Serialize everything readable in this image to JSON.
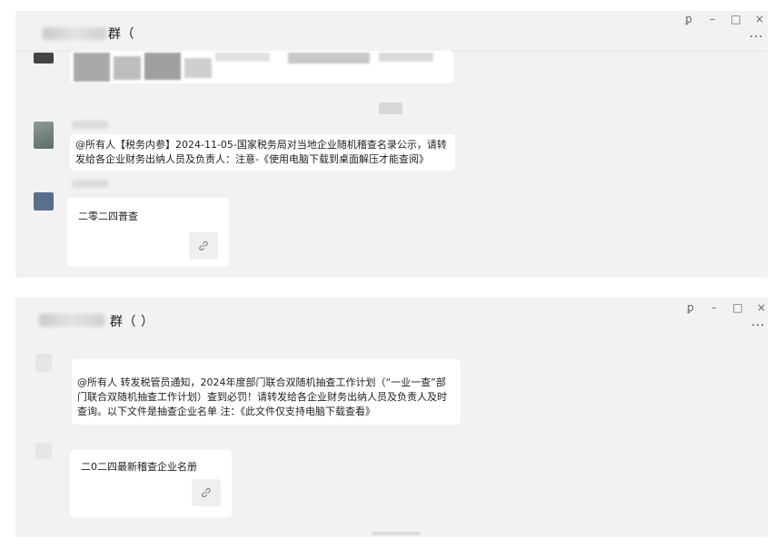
{
  "window_controls": {
    "pin": "ꝑ",
    "minimize": "–",
    "maximize": "□",
    "close": "×",
    "more": "···"
  },
  "panel1": {
    "title": "群（",
    "messages": [
      {
        "text": "@所有人【税务内参】2024-11-05-国家税务局对当地企业随机稽查名录公示，请转发给各企业财务出纳人员及负责人：注意-《使用电脑下载到桌面解压才能查阅》"
      }
    ],
    "card": {
      "title": "二零二四普查"
    }
  },
  "panel2": {
    "title": "群（ ）",
    "messages": [
      {
        "text": "@所有人 转发税管员通知，2024年度部门联合双随机抽查工作计划（“一业一查”部门联合双随机抽查工作计划）查到必罚！请转发给各企业财务出纳人员及负责人及时查询。以下文件是抽查企业名单 注：《此文件仅支持电脑下载查看》"
      }
    ],
    "card": {
      "title": "二0二四最新稽查企业名册"
    }
  },
  "colors": {
    "panel_bg": "#f2f2f2",
    "bubble_bg": "#ffffff",
    "link_box": "#efefef"
  }
}
